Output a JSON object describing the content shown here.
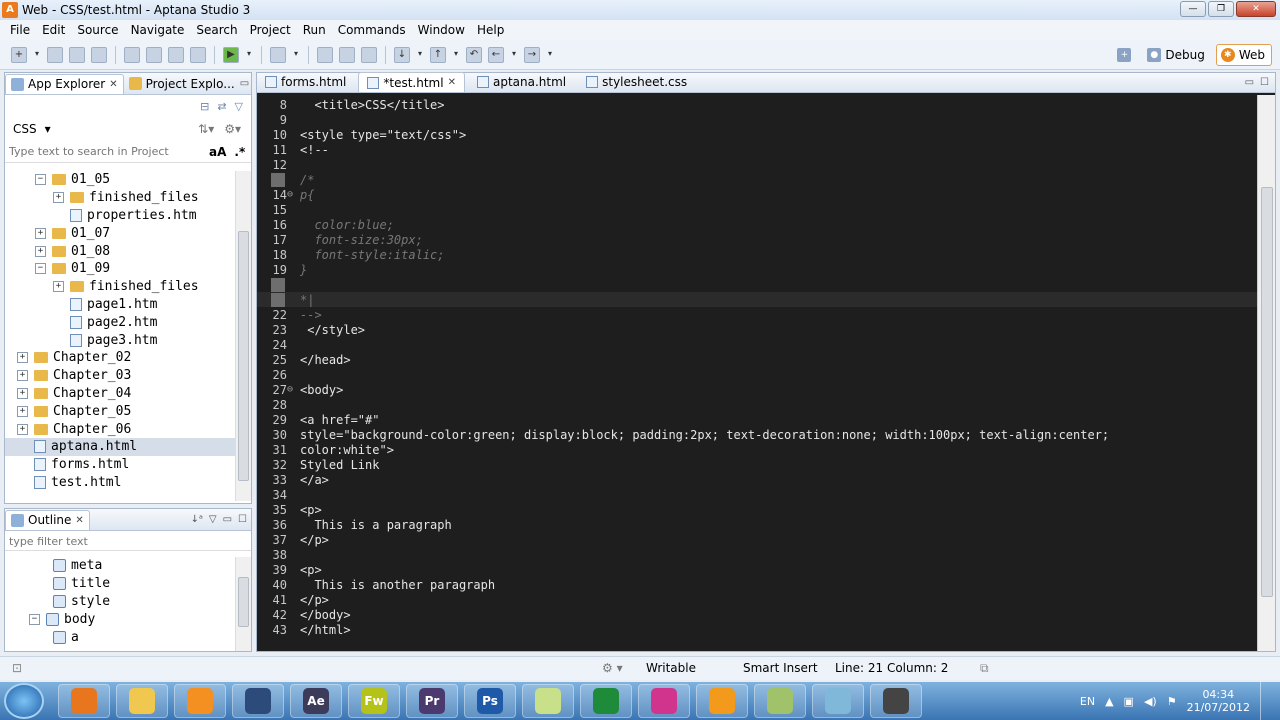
{
  "window": {
    "title": "Web - CSS/test.html - Aptana Studio 3"
  },
  "menu": [
    "File",
    "Edit",
    "Source",
    "Navigate",
    "Search",
    "Project",
    "Run",
    "Commands",
    "Window",
    "Help"
  ],
  "perspectives": {
    "debug": "Debug",
    "web": "Web"
  },
  "left_panel": {
    "tabs": [
      "App Explorer",
      "Project Explo..."
    ],
    "project": "CSS",
    "search_placeholder": "Type text to search in Project",
    "search_opts": [
      "aA",
      ".*"
    ],
    "tree": [
      {
        "label": "01_05",
        "type": "folder",
        "depth": 1,
        "exp": "-"
      },
      {
        "label": "finished_files",
        "type": "folder",
        "depth": 2,
        "exp": "+"
      },
      {
        "label": "properties.htm",
        "type": "file",
        "depth": 2,
        "exp": ""
      },
      {
        "label": "01_07",
        "type": "folder",
        "depth": 1,
        "exp": "+"
      },
      {
        "label": "01_08",
        "type": "folder",
        "depth": 1,
        "exp": "+"
      },
      {
        "label": "01_09",
        "type": "folder",
        "depth": 1,
        "exp": "-"
      },
      {
        "label": "finished_files",
        "type": "folder",
        "depth": 2,
        "exp": "+"
      },
      {
        "label": "page1.htm",
        "type": "file",
        "depth": 2,
        "exp": ""
      },
      {
        "label": "page2.htm",
        "type": "file",
        "depth": 2,
        "exp": ""
      },
      {
        "label": "page3.htm",
        "type": "file",
        "depth": 2,
        "exp": ""
      },
      {
        "label": "Chapter_02",
        "type": "folder",
        "depth": 0,
        "exp": "+"
      },
      {
        "label": "Chapter_03",
        "type": "folder",
        "depth": 0,
        "exp": "+"
      },
      {
        "label": "Chapter_04",
        "type": "folder",
        "depth": 0,
        "exp": "+"
      },
      {
        "label": "Chapter_05",
        "type": "folder",
        "depth": 0,
        "exp": "+"
      },
      {
        "label": "Chapter_06",
        "type": "folder",
        "depth": 0,
        "exp": "+"
      },
      {
        "label": "aptana.html",
        "type": "file",
        "depth": 0,
        "exp": "",
        "selected": true
      },
      {
        "label": "forms.html",
        "type": "file",
        "depth": 0,
        "exp": ""
      },
      {
        "label": "test.html",
        "type": "file",
        "depth": 0,
        "exp": ""
      }
    ]
  },
  "outline": {
    "tab": "Outline",
    "filter_placeholder": "type filter text",
    "tree": [
      {
        "label": "meta",
        "depth": 1,
        "exp": ""
      },
      {
        "label": "title",
        "depth": 1,
        "exp": ""
      },
      {
        "label": "style",
        "depth": 1,
        "exp": ""
      },
      {
        "label": "body",
        "depth": 0,
        "exp": "-"
      },
      {
        "label": "a",
        "depth": 1,
        "exp": ""
      }
    ]
  },
  "editor": {
    "tabs": [
      {
        "label": "forms.html",
        "active": false
      },
      {
        "label": "*test.html",
        "active": true
      },
      {
        "label": "aptana.html",
        "active": false
      },
      {
        "label": "stylesheet.css",
        "active": false
      }
    ],
    "lines": [
      {
        "n": "8",
        "t": "  <title>CSS</title>",
        "c": "tag"
      },
      {
        "n": "9",
        "t": "",
        "c": "tag"
      },
      {
        "n": "10",
        "t": "<style type=\"text/css\">",
        "c": "tag"
      },
      {
        "n": "11",
        "t": "<!--",
        "c": "tag"
      },
      {
        "n": "12",
        "t": "",
        "c": "tag"
      },
      {
        "n": "",
        "t": "/*",
        "c": "cmt",
        "mark": true
      },
      {
        "n": "14",
        "t": "p{",
        "c": "cmt",
        "fold": "⊖"
      },
      {
        "n": "15",
        "t": "",
        "c": "cmt"
      },
      {
        "n": "16",
        "t": "  color:blue;",
        "c": "cmt"
      },
      {
        "n": "17",
        "t": "  font-size:30px;",
        "c": "cmt"
      },
      {
        "n": "18",
        "t": "  font-style:italic;",
        "c": "cmt"
      },
      {
        "n": "19",
        "t": "}",
        "c": "cmt"
      },
      {
        "n": "",
        "t": "",
        "c": "tag",
        "mark": true
      },
      {
        "n": "",
        "t": "*|",
        "c": "cmt",
        "mark": true,
        "cur": true
      },
      {
        "n": "22",
        "t": "-->",
        "c": "cmt"
      },
      {
        "n": "23",
        "t": " </style>",
        "c": "tag"
      },
      {
        "n": "24",
        "t": "",
        "c": "tag"
      },
      {
        "n": "25",
        "t": "</head>",
        "c": "tag"
      },
      {
        "n": "26",
        "t": "",
        "c": "tag"
      },
      {
        "n": "27",
        "t": "<body>",
        "c": "tag",
        "fold": "⊖"
      },
      {
        "n": "28",
        "t": "",
        "c": "tag"
      },
      {
        "n": "29",
        "t": "<a href=\"#\"",
        "c": "tag"
      },
      {
        "n": "30",
        "t": "style=\"background-color:green; display:block; padding:2px; text-decoration:none; width:100px; text-align:center;",
        "c": "tag"
      },
      {
        "n": "31",
        "t": "color:white\">",
        "c": "tag"
      },
      {
        "n": "32",
        "t": "Styled Link",
        "c": "tag"
      },
      {
        "n": "33",
        "t": "</a>",
        "c": "tag"
      },
      {
        "n": "34",
        "t": "",
        "c": "tag"
      },
      {
        "n": "35",
        "t": "<p>",
        "c": "tag"
      },
      {
        "n": "36",
        "t": "  This is a paragraph",
        "c": "tag"
      },
      {
        "n": "37",
        "t": "</p>",
        "c": "tag"
      },
      {
        "n": "38",
        "t": "",
        "c": "tag"
      },
      {
        "n": "39",
        "t": "<p>",
        "c": "tag"
      },
      {
        "n": "40",
        "t": "  This is another paragraph",
        "c": "tag"
      },
      {
        "n": "41",
        "t": "</p>",
        "c": "tag"
      },
      {
        "n": "42",
        "t": "</body>",
        "c": "tag"
      },
      {
        "n": "43",
        "t": "</html>",
        "c": "tag"
      }
    ]
  },
  "status": {
    "writable": "Writable",
    "insert": "Smart Insert",
    "position": "Line: 21 Column: 2"
  },
  "taskbar": {
    "apps": [
      {
        "label": "",
        "color": "#e8761e"
      },
      {
        "label": "",
        "color": "#f0c850"
      },
      {
        "label": "",
        "color": "#f39021"
      },
      {
        "label": "",
        "color": "#2c4a7a"
      },
      {
        "label": "Ae",
        "color": "#3c3c5a"
      },
      {
        "label": "Fw",
        "color": "#b5c21a"
      },
      {
        "label": "Pr",
        "color": "#4b3a6e"
      },
      {
        "label": "Ps",
        "color": "#1f5aa8"
      },
      {
        "label": "",
        "color": "#c8e089"
      },
      {
        "label": "",
        "color": "#1d8b3a"
      },
      {
        "label": "",
        "color": "#d0348c"
      },
      {
        "label": "",
        "color": "#f39a1c"
      },
      {
        "label": "",
        "color": "#9fc26a"
      },
      {
        "label": "",
        "color": "#7fb8d8"
      },
      {
        "label": "",
        "color": "#444444"
      }
    ],
    "lang": "EN",
    "time": "04:34",
    "date": "21/07/2012"
  }
}
